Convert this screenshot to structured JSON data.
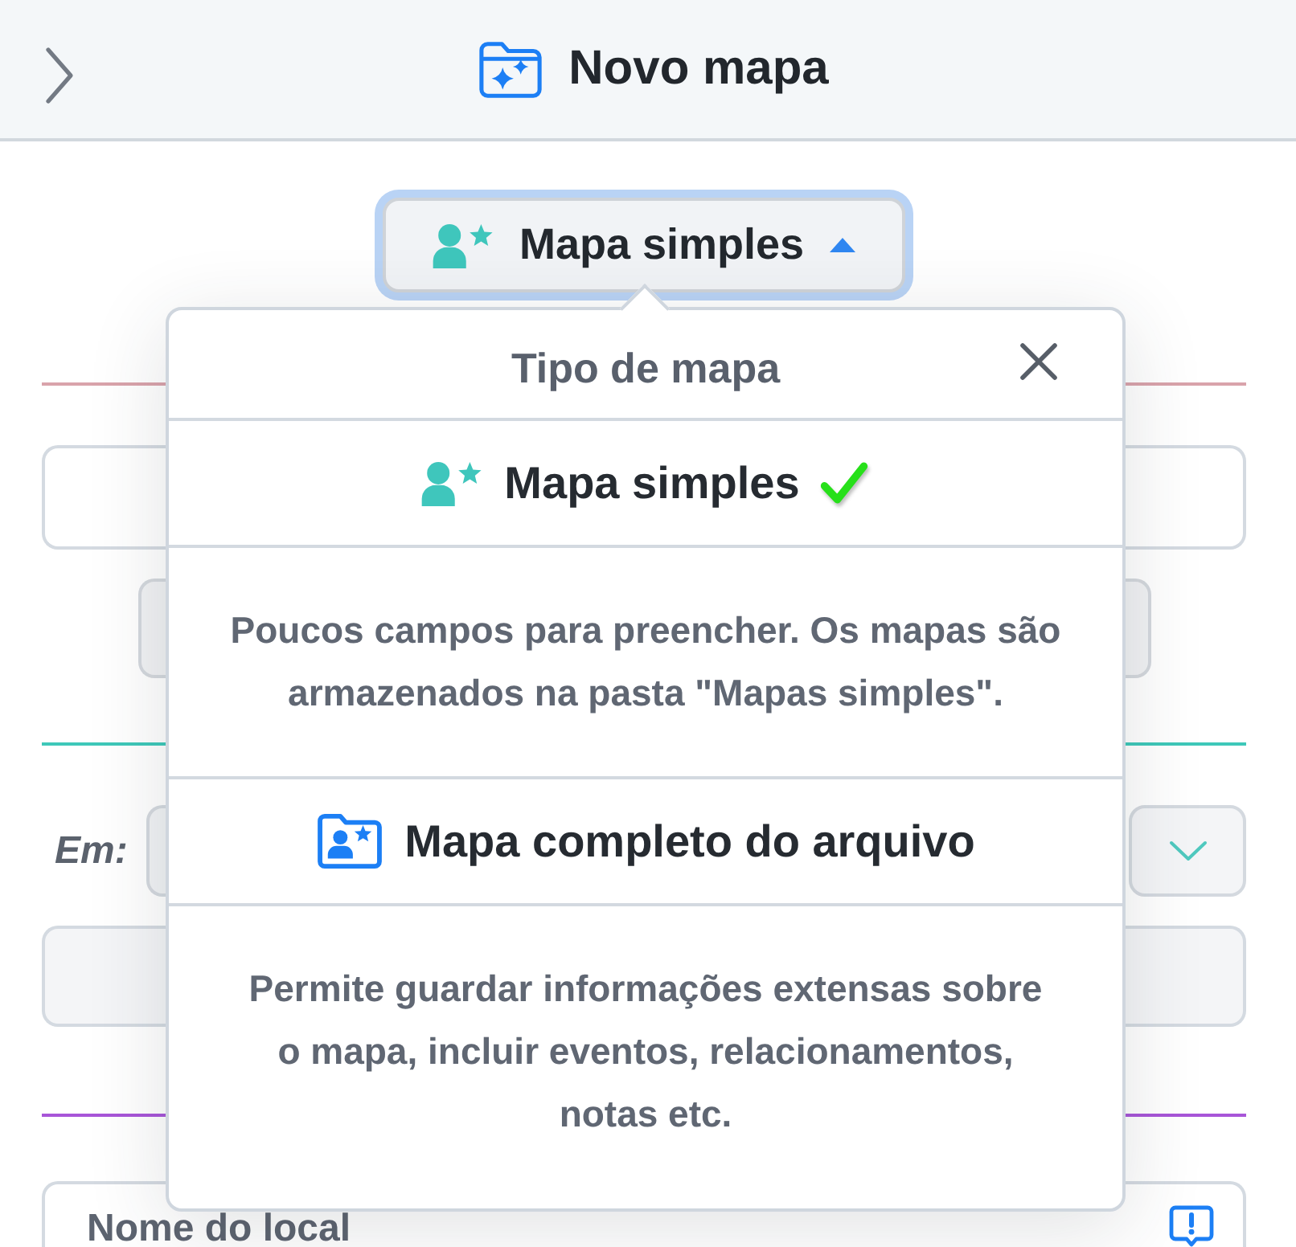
{
  "header": {
    "title": "Novo mapa"
  },
  "map_type_button": {
    "label": "Mapa simples",
    "kind": "simple",
    "expanded": true
  },
  "form": [
    {
      "kind": "divider",
      "color": "#d9a3ab"
    },
    {
      "kind": "field",
      "disabled": false,
      "alert": false
    },
    {
      "kind": "button"
    },
    {
      "kind": "divider",
      "color": "#3ec8b9"
    },
    {
      "kind": "select",
      "label": "Em:"
    },
    {
      "kind": "field",
      "disabled": true,
      "alert": false
    },
    {
      "kind": "divider",
      "color": "#a855d8"
    },
    {
      "kind": "field",
      "disabled": false,
      "alert": true,
      "placeholder": "Nome do local"
    }
  ],
  "popover": {
    "title": "Tipo de mapa",
    "options": [
      {
        "kind": "simple",
        "label": "Mapa simples",
        "selected": true,
        "description": "Poucos campos para preencher. Os mapas são\narmazenados na pasta \"Mapas simples\"."
      },
      {
        "kind": "full",
        "label": "Mapa completo do arquivo",
        "selected": false,
        "description": "Permite guardar informações extensas sobre\no mapa, incluir eventos, relacionamentos,\nnotas etc."
      }
    ]
  }
}
